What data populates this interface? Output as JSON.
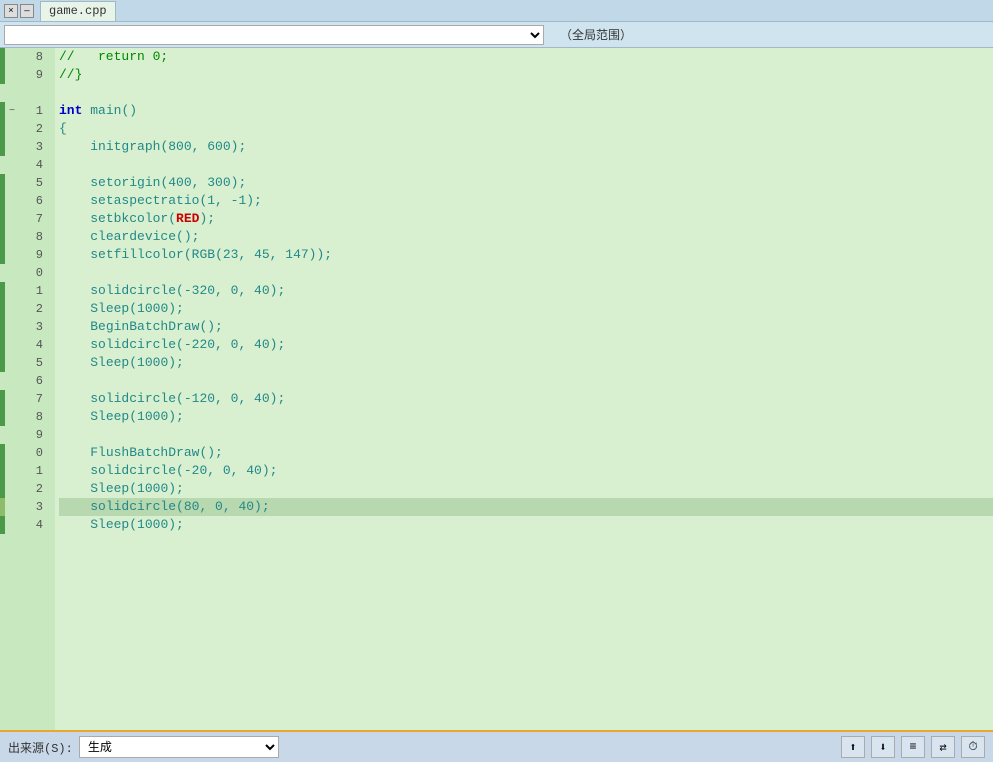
{
  "titlebar": {
    "buttons": [
      "×",
      "—",
      "□"
    ],
    "tab": "game.cpp"
  },
  "toolbar": {
    "scope_placeholder": "",
    "scope_label": "（全局范围）"
  },
  "lines": [
    {
      "num": "8",
      "bar": "dark",
      "fold": "",
      "code": [
        {
          "t": "cm",
          "v": "//   return 0;"
        }
      ]
    },
    {
      "num": "9",
      "bar": "dark",
      "fold": "",
      "code": [
        {
          "t": "cm",
          "v": "//}"
        }
      ]
    },
    {
      "num": "",
      "bar": "empty",
      "fold": "",
      "code": []
    },
    {
      "num": "1",
      "bar": "dark",
      "fold": "−",
      "code": [
        {
          "t": "kw",
          "v": "int"
        },
        {
          "t": "plain",
          "v": " "
        },
        {
          "t": "fn",
          "v": "main"
        },
        {
          "t": "plain",
          "v": "()"
        }
      ]
    },
    {
      "num": "2",
      "bar": "dark",
      "fold": "",
      "code": [
        {
          "t": "plain",
          "v": "{"
        }
      ]
    },
    {
      "num": "3",
      "bar": "dark",
      "fold": "",
      "code": [
        {
          "t": "plain",
          "v": "    "
        },
        {
          "t": "fn",
          "v": "initgraph"
        },
        {
          "t": "plain",
          "v": "(800, 600);"
        }
      ]
    },
    {
      "num": "4",
      "bar": "empty",
      "fold": "",
      "code": []
    },
    {
      "num": "5",
      "bar": "dark",
      "fold": "",
      "code": [
        {
          "t": "plain",
          "v": "    "
        },
        {
          "t": "fn",
          "v": "setorigin"
        },
        {
          "t": "plain",
          "v": "(400, 300);"
        }
      ]
    },
    {
      "num": "6",
      "bar": "dark",
      "fold": "",
      "code": [
        {
          "t": "plain",
          "v": "    "
        },
        {
          "t": "fn",
          "v": "setaspectratio"
        },
        {
          "t": "plain",
          "v": "(1, -1);"
        }
      ]
    },
    {
      "num": "7",
      "bar": "dark",
      "fold": "",
      "code": [
        {
          "t": "plain",
          "v": "    "
        },
        {
          "t": "fn",
          "v": "setbkcolor"
        },
        {
          "t": "plain",
          "v": "("
        },
        {
          "t": "red-kw",
          "v": "RED"
        },
        {
          "t": "plain",
          "v": ");"
        }
      ]
    },
    {
      "num": "8",
      "bar": "dark",
      "fold": "",
      "code": [
        {
          "t": "plain",
          "v": "    "
        },
        {
          "t": "fn",
          "v": "cleardevice"
        },
        {
          "t": "plain",
          "v": "();"
        }
      ]
    },
    {
      "num": "9",
      "bar": "dark",
      "fold": "",
      "code": [
        {
          "t": "plain",
          "v": "    "
        },
        {
          "t": "fn",
          "v": "setfillcolor"
        },
        {
          "t": "plain",
          "v": "("
        },
        {
          "t": "fn",
          "v": "RGB"
        },
        {
          "t": "plain",
          "v": "(23, 45, 147));"
        }
      ]
    },
    {
      "num": "0",
      "bar": "empty",
      "fold": "",
      "code": []
    },
    {
      "num": "1",
      "bar": "dark",
      "fold": "",
      "code": [
        {
          "t": "plain",
          "v": "    "
        },
        {
          "t": "fn",
          "v": "solidcircle"
        },
        {
          "t": "plain",
          "v": "(-320, 0, 40);"
        }
      ]
    },
    {
      "num": "2",
      "bar": "dark",
      "fold": "",
      "code": [
        {
          "t": "plain",
          "v": "    "
        },
        {
          "t": "fn",
          "v": "Sleep"
        },
        {
          "t": "plain",
          "v": "(1000);"
        }
      ]
    },
    {
      "num": "3",
      "bar": "dark",
      "fold": "",
      "code": [
        {
          "t": "plain",
          "v": "    "
        },
        {
          "t": "fn",
          "v": "BeginBatchDraw"
        },
        {
          "t": "plain",
          "v": "();"
        }
      ]
    },
    {
      "num": "4",
      "bar": "dark",
      "fold": "",
      "code": [
        {
          "t": "plain",
          "v": "    "
        },
        {
          "t": "fn",
          "v": "solidcircle"
        },
        {
          "t": "plain",
          "v": "(-220, 0, 40);"
        }
      ]
    },
    {
      "num": "5",
      "bar": "dark",
      "fold": "",
      "code": [
        {
          "t": "plain",
          "v": "    "
        },
        {
          "t": "fn",
          "v": "Sleep"
        },
        {
          "t": "plain",
          "v": "(1000);"
        }
      ]
    },
    {
      "num": "6",
      "bar": "empty",
      "fold": "",
      "code": []
    },
    {
      "num": "7",
      "bar": "dark",
      "fold": "",
      "code": [
        {
          "t": "plain",
          "v": "    "
        },
        {
          "t": "fn",
          "v": "solidcircle"
        },
        {
          "t": "plain",
          "v": "(-120, 0, 40);"
        }
      ]
    },
    {
      "num": "8",
      "bar": "dark",
      "fold": "",
      "code": [
        {
          "t": "plain",
          "v": "    "
        },
        {
          "t": "fn",
          "v": "Sleep"
        },
        {
          "t": "plain",
          "v": "(1000);"
        }
      ]
    },
    {
      "num": "9",
      "bar": "empty",
      "fold": "",
      "code": []
    },
    {
      "num": "0",
      "bar": "dark",
      "fold": "",
      "code": [
        {
          "t": "plain",
          "v": "    "
        },
        {
          "t": "fn",
          "v": "FlushBatchDraw"
        },
        {
          "t": "plain",
          "v": "();"
        }
      ]
    },
    {
      "num": "1",
      "bar": "dark",
      "fold": "",
      "code": [
        {
          "t": "plain",
          "v": "    "
        },
        {
          "t": "fn",
          "v": "solidcircle"
        },
        {
          "t": "plain",
          "v": "(-20, 0, 40);"
        }
      ]
    },
    {
      "num": "2",
      "bar": "dark",
      "fold": "",
      "code": [
        {
          "t": "plain",
          "v": "    "
        },
        {
          "t": "fn",
          "v": "Sleep"
        },
        {
          "t": "plain",
          "v": "(1000);"
        }
      ]
    },
    {
      "num": "3",
      "bar": "light",
      "fold": "",
      "code": [
        {
          "t": "plain",
          "v": "    "
        },
        {
          "t": "fn",
          "v": "solidcircle"
        },
        {
          "t": "plain",
          "v": "(80, 0, 40);"
        }
      ],
      "highlight": true
    },
    {
      "num": "4",
      "bar": "dark",
      "fold": "",
      "code": [
        {
          "t": "plain",
          "v": "    "
        },
        {
          "t": "fn",
          "v": "Sleep"
        },
        {
          "t": "plain",
          "v": "(1000);"
        }
      ]
    }
  ],
  "bottom": {
    "source_label": "出来源(S):",
    "source_value": "生成",
    "icons": [
      "⬆",
      "⬇",
      "≡",
      "⇄",
      "⏱"
    ]
  }
}
